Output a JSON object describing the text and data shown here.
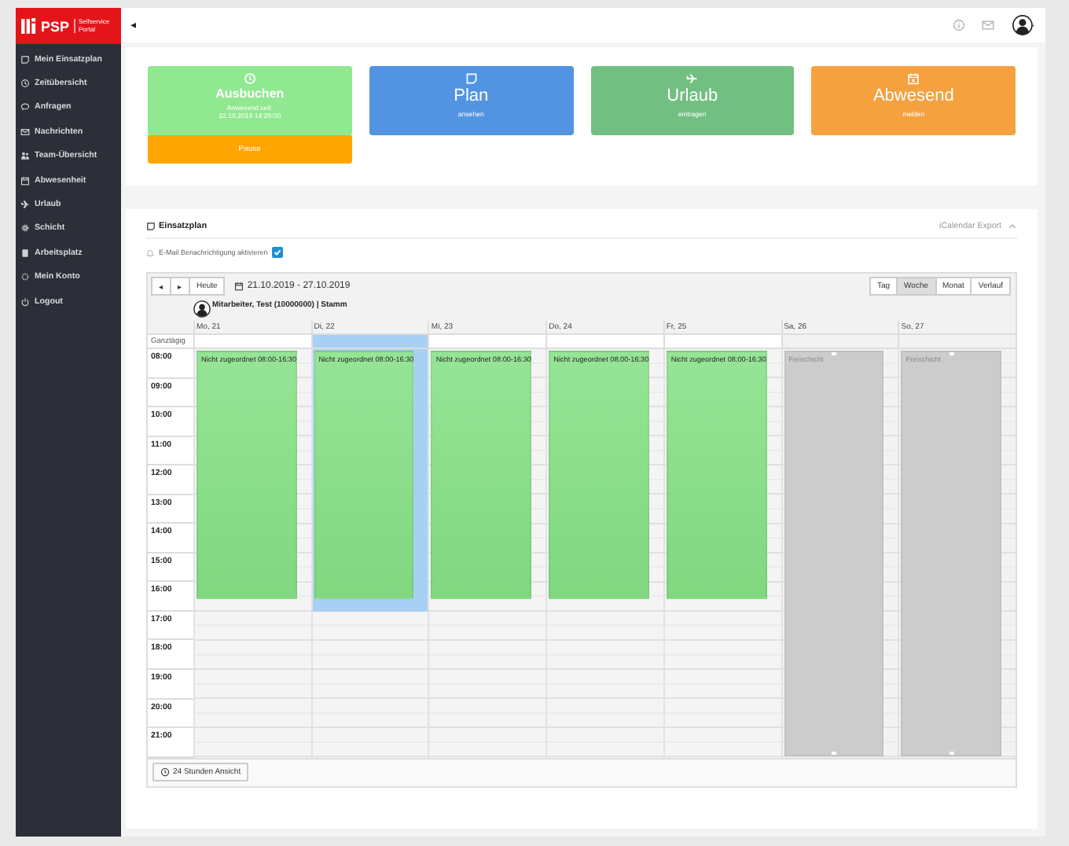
{
  "sidebar": {
    "logo": {
      "brand": "PSP",
      "subtitle": "Selfservice Portal"
    },
    "items": [
      {
        "label": "Mein Einsatzplan"
      },
      {
        "label": "Zeitübersicht"
      },
      {
        "label": "Anfragen"
      },
      {
        "label": "Nachrichten"
      },
      {
        "label": "Team-Übersicht"
      },
      {
        "label": "Abwesenheit"
      },
      {
        "label": "Urlaub"
      },
      {
        "label": "Schicht"
      },
      {
        "label": "Arbeitsplatz"
      },
      {
        "label": "Mein Konto"
      },
      {
        "label": "Logout"
      }
    ]
  },
  "topbar": {
    "collapse": "◂"
  },
  "tiles": [
    {
      "kind": "large",
      "title": "Ausbuchen",
      "subtitle": [
        "Anwesend seit:",
        "22.10.2019 14:29:00"
      ],
      "color": "#90e890",
      "action": {
        "label": "Pause",
        "color": "#ffa500"
      }
    },
    {
      "kind": "big",
      "title": "Plan",
      "subtitle": [
        "ansehen"
      ],
      "color": "#5294e2"
    },
    {
      "kind": "big",
      "title": "Urlaub",
      "subtitle": [
        "eintragen"
      ],
      "color": "#72bf82"
    },
    {
      "kind": "big",
      "title": "Abwesend",
      "subtitle": [
        "melden"
      ],
      "color": "#f5a140"
    }
  ],
  "schedule": {
    "title": "Einsatzplan",
    "export": "iCalendar Export",
    "notify": {
      "label": "E-Mail Benachrichtigung aktivieren",
      "checked": true
    },
    "toolbar": {
      "prev": "◂",
      "next": "▸",
      "today": "Heute",
      "range": "21.10.2019 - 27.10.2019",
      "views": [
        {
          "label": "Tag",
          "selected": false
        },
        {
          "label": "Woche",
          "selected": true
        },
        {
          "label": "Monat",
          "selected": false
        },
        {
          "label": "Verlauf",
          "selected": false
        }
      ]
    },
    "person": "Mitarbeiter, Test (10000000) | Stamm",
    "allday": "Ganztägig",
    "days": [
      {
        "label": "Mo, 21",
        "selected": false,
        "kind": "weekday",
        "event": {
          "kind": "shift",
          "text": "Nicht zugeordnet 08:00-16:30"
        }
      },
      {
        "label": "Di, 22",
        "selected": true,
        "kind": "weekday",
        "event": {
          "kind": "shift",
          "text": "Nicht zugeordnet 08:00-16:30"
        }
      },
      {
        "label": "Mi, 23",
        "selected": false,
        "kind": "weekday",
        "event": {
          "kind": "shift",
          "text": "Nicht zugeordnet 08:00-16:30"
        }
      },
      {
        "label": "Do, 24",
        "selected": false,
        "kind": "weekday",
        "event": {
          "kind": "shift",
          "text": "Nicht zugeordnet 08:00-16:30"
        }
      },
      {
        "label": "Fr, 25",
        "selected": false,
        "kind": "weekday",
        "event": {
          "kind": "shift",
          "text": "Nicht zugeordnet 08:00-16:30"
        }
      },
      {
        "label": "Sa, 26",
        "selected": false,
        "kind": "weekend",
        "event": {
          "kind": "free",
          "text": "Freischicht"
        }
      },
      {
        "label": "So, 27",
        "selected": false,
        "kind": "weekend",
        "event": {
          "kind": "free",
          "text": "Freischicht"
        }
      }
    ],
    "hours": [
      "08:00",
      "09:00",
      "10:00",
      "11:00",
      "12:00",
      "13:00",
      "14:00",
      "15:00",
      "16:00",
      "17:00",
      "18:00",
      "19:00",
      "20:00",
      "21:00"
    ],
    "footer_button": "24 Stunden Ansicht"
  }
}
